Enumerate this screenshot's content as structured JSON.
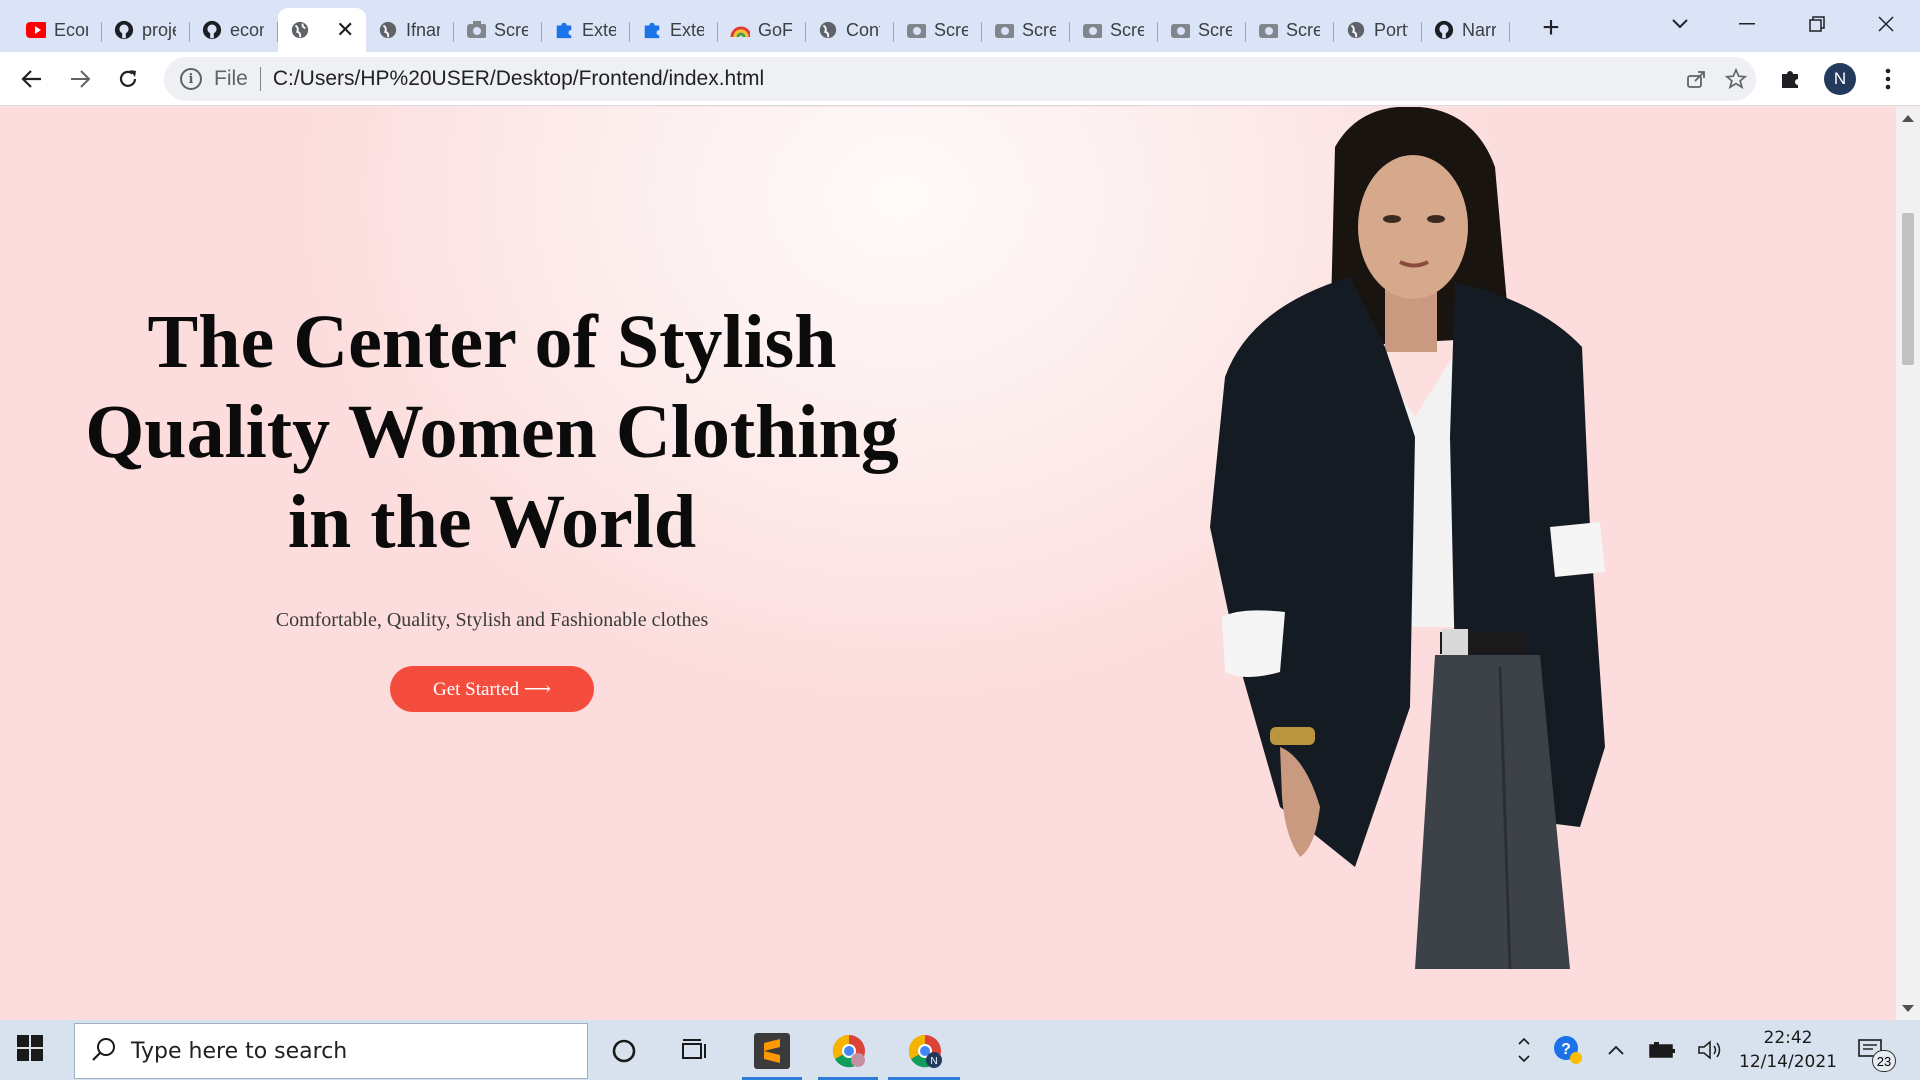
{
  "browser": {
    "tabs": [
      {
        "title": "Economic",
        "icon": "youtube-icon"
      },
      {
        "title": "project",
        "icon": "github-icon"
      },
      {
        "title": "ecommerce",
        "icon": "github-icon"
      },
      {
        "title": "",
        "icon": "globe-icon",
        "active": true
      },
      {
        "title": "Ifnanyi",
        "icon": "globe-icon"
      },
      {
        "title": "Screenshot",
        "icon": "camera-icon"
      },
      {
        "title": "Extensions",
        "icon": "puzzle-icon"
      },
      {
        "title": "Extensions",
        "icon": "puzzle-icon"
      },
      {
        "title": "GoFundMe",
        "icon": "rainbow-icon"
      },
      {
        "title": "Contact",
        "icon": "globe-icon"
      },
      {
        "title": "Screenshot",
        "icon": "camera-icon"
      },
      {
        "title": "Screenshot",
        "icon": "camera-icon"
      },
      {
        "title": "Screenshot",
        "icon": "camera-icon"
      },
      {
        "title": "Screenshot",
        "icon": "camera-icon"
      },
      {
        "title": "Screenshot",
        "icon": "camera-icon"
      },
      {
        "title": "Portfolio",
        "icon": "globe-icon"
      },
      {
        "title": "Narrative",
        "icon": "github-icon"
      }
    ],
    "new_tab_label": "+",
    "close_tab_label": "✕",
    "address": {
      "scheme_label": "File",
      "url": "C:/Users/HP%20USER/Desktop/Frontend/index.html"
    },
    "profile_initial": "N"
  },
  "page": {
    "hero_title_lines": [
      "The Center of Stylish",
      "Quality Women Clothing",
      "in the World"
    ],
    "hero_subtitle": "Comfortable, Quality, Stylish and Fashionable clothes",
    "cta_label": "Get Started ⟶"
  },
  "taskbar": {
    "search_placeholder": "Type here to search",
    "time": "22:42",
    "date": "12/14/2021",
    "notification_count": "23"
  },
  "colors": {
    "accent": "#f54d3d",
    "tabstrip": "#dbe3f7",
    "page_bg": "#fde4e4"
  }
}
